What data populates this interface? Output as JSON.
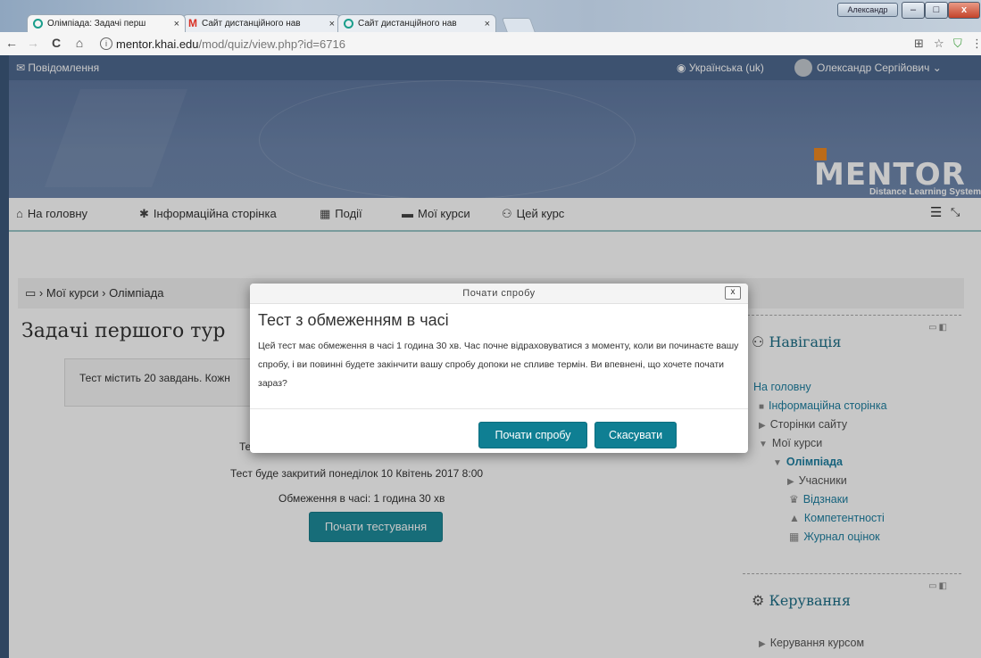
{
  "window": {
    "user_badge": "Александр",
    "min": "–",
    "max": "□",
    "close": "x"
  },
  "tabs": [
    {
      "title": "Олімпіада: Задачі перш",
      "close": "×"
    },
    {
      "title": "Сайт дистанційного нав",
      "close": "×"
    },
    {
      "title": "Сайт дистанційного нав",
      "close": "×"
    }
  ],
  "browser": {
    "back": "←",
    "forward": "→",
    "reload": "C",
    "home": "⌂",
    "info": "i",
    "url_host": "mentor.khai.edu",
    "url_path": "/mod/quiz/view.php?id=6716",
    "translate_icon": "⊞",
    "star_icon": "☆",
    "shield_icon": "⛉",
    "menu_icon": "⋮"
  },
  "topnav": {
    "messages": "Повідомлення",
    "language": "Українська (uk)",
    "user": "Олександр Сергійович"
  },
  "logo": {
    "title": "MENTOR",
    "subtitle": "Distance Learning System"
  },
  "mainnav": [
    {
      "icon": "⌂",
      "label": "На головну"
    },
    {
      "icon": "✱",
      "label": "Інформаційна сторінка"
    },
    {
      "icon": "▦",
      "label": "Події"
    },
    {
      "icon": "▬",
      "label": "Мої курси"
    },
    {
      "icon": "⚇",
      "label": "Цей курс"
    }
  ],
  "breadcrumb": {
    "home_icon": "▭",
    "sep": "›",
    "items": [
      "Мої курси",
      "Олімпіада"
    ]
  },
  "main": {
    "title": "Задачі першого тур",
    "intro": "Тест містить 20 завдань. Кожн",
    "partial_line": "Те",
    "closes": "Тест буде закритий понеділок 10 Квітень 2017 8:00",
    "time_limit": "Обмеження в часі: 1 година 30 хв",
    "start_button": "Почати тестування"
  },
  "nav_block": {
    "title": "Навігація",
    "controls": "▭◧",
    "items": [
      "На головну",
      "Інформаційна сторінка",
      "Сторінки сайту",
      "Мої курси",
      "Олімпіада",
      "Учасники",
      "Відзнаки",
      "Компетентності",
      "Журнал оцінок"
    ]
  },
  "admin_block": {
    "title": "Керування",
    "controls": "▭◧",
    "items": [
      "Керування курсом"
    ]
  },
  "modal": {
    "titlebar": "Почати спробу",
    "close": "x",
    "heading": "Тест з обмеженням в часі",
    "body": "Цей тест має обмеження в часі 1 година 30 хв. Час почне відраховуватися з моменту, коли ви починаєте вашу спробу, і ви повинні будете закінчити вашу спробу допоки не спливе термін. Ви впевнені, що хочете почати зараз?",
    "confirm": "Почати спробу",
    "cancel": "Скасувати"
  }
}
